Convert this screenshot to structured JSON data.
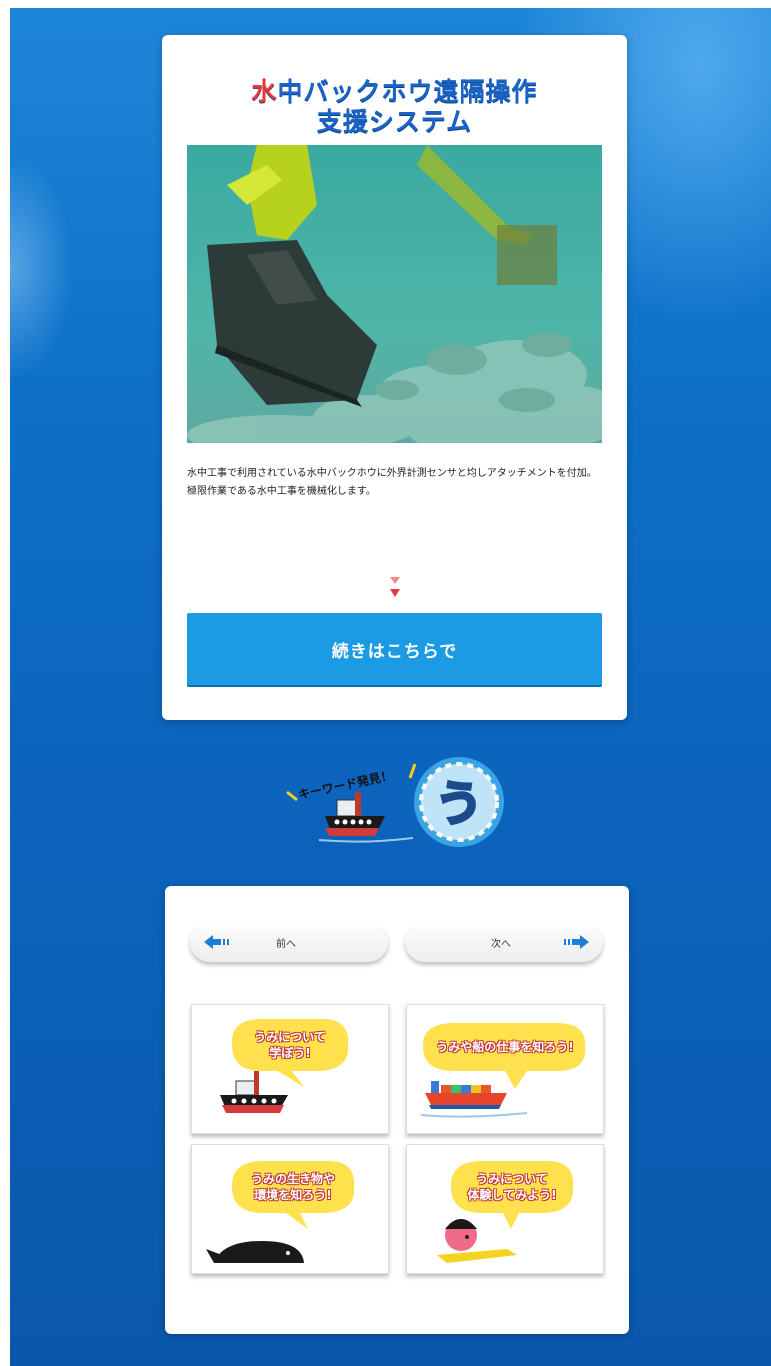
{
  "header": {
    "title_accent": "水",
    "title_line1_rest": "中バックホウ遠隔操作",
    "title_line2": "支援システム"
  },
  "article": {
    "description_line1": "水中工事で利用されている水中バックホウに外界計測センサと均しアタッチメントを付加。",
    "description_line2": "極限作業である水中工事を機械化します。",
    "cta_label": "続きはこちらで"
  },
  "keyword": {
    "label": "キーワード発見！",
    "letter": "う"
  },
  "navigation": {
    "prev_label": "前へ",
    "next_label": "次へ"
  },
  "tiles": [
    {
      "line1": "うみについて",
      "line2": "学ぼう!"
    },
    {
      "line1": "うみや船の仕事を知ろう!"
    },
    {
      "line1": "うみの生き物や",
      "line2": "環境を知ろう!"
    },
    {
      "line1": "うみについて",
      "line2": "体験してみよう!"
    }
  ],
  "colors": {
    "accent_red": "#e6383a",
    "title_blue": "#1a64c8",
    "cta_blue": "#1c9be4",
    "bubble_yellow": "#ffe14d"
  }
}
